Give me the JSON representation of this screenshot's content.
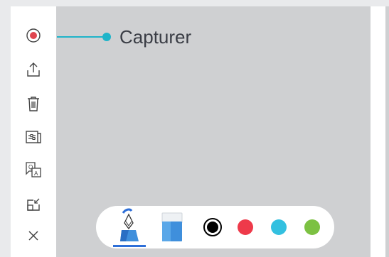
{
  "toolbar": {
    "tools": [
      {
        "name": "record-icon",
        "color": "#e0454f"
      },
      {
        "name": "share-icon"
      },
      {
        "name": "trash-icon"
      },
      {
        "name": "settings-panel-icon"
      },
      {
        "name": "qa-icon",
        "glyph_top": "Q",
        "glyph_bottom": "A"
      },
      {
        "name": "minimize-icon"
      },
      {
        "name": "close-icon"
      }
    ]
  },
  "callout": {
    "label": "Capturer",
    "color": "#1fb4c9"
  },
  "palette": {
    "tools": [
      "pen-icon",
      "eraser-icon"
    ],
    "selected_tool": "pen",
    "colors": [
      "#000000",
      "#ee3a4a",
      "#33c0e0",
      "#7cc142"
    ],
    "selected_color": "#000000"
  }
}
